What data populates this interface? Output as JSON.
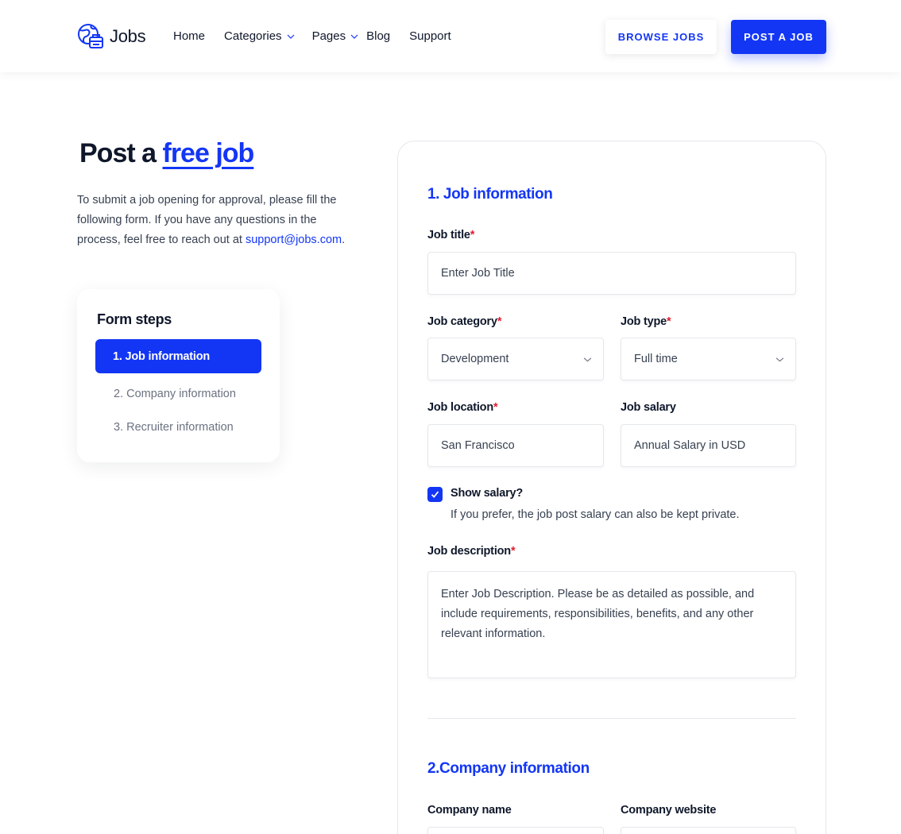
{
  "brand": {
    "name": "Jobs",
    "logo_icon": "globe-briefcase-icon",
    "accent": "#1336F5"
  },
  "nav": {
    "home": "Home",
    "categories": "Categories",
    "pages": "Pages",
    "blog": "Blog",
    "support": "Support"
  },
  "header_buttons": {
    "browse": "BROWSE JOBS",
    "post": "POST A JOB"
  },
  "hero": {
    "title_prefix": "Post a",
    "title_accent": "free job",
    "intro_text": "To submit a job opening for approval, please fill the following form. If you have any questions in the process, feel free to reach out at",
    "email": "support@jobs.com",
    "intro_end": "."
  },
  "steps": {
    "title": "Form steps",
    "items": [
      "1. Job information",
      "2. Company information",
      "3. Recruiter information"
    ]
  },
  "form": {
    "section1_title": "1. Job information",
    "job_title": {
      "label": "Job title",
      "required": "*",
      "placeholder": "Enter Job Title"
    },
    "job_category": {
      "label": "Job category",
      "required": "*",
      "value": "Development"
    },
    "job_type": {
      "label": "Job type",
      "required": "*",
      "value": "Full time"
    },
    "job_location": {
      "label": "Job location",
      "required": "*",
      "value": "San Francisco"
    },
    "job_salary": {
      "label": "Job salary",
      "placeholder": "Annual Salary in USD"
    },
    "show_salary": {
      "label": "Show salary?",
      "checked": true,
      "help": "If you prefer, the job post salary can also be kept private."
    },
    "job_description": {
      "label": "Job description",
      "required": "*",
      "placeholder": "Enter Job Description. Please be as detailed as possible, and include requirements, responsibilities, benefits, and any other relevant information."
    },
    "section2_title": "2.Company information",
    "company_name": {
      "label": "Company name"
    },
    "company_website": {
      "label": "Company website"
    }
  }
}
